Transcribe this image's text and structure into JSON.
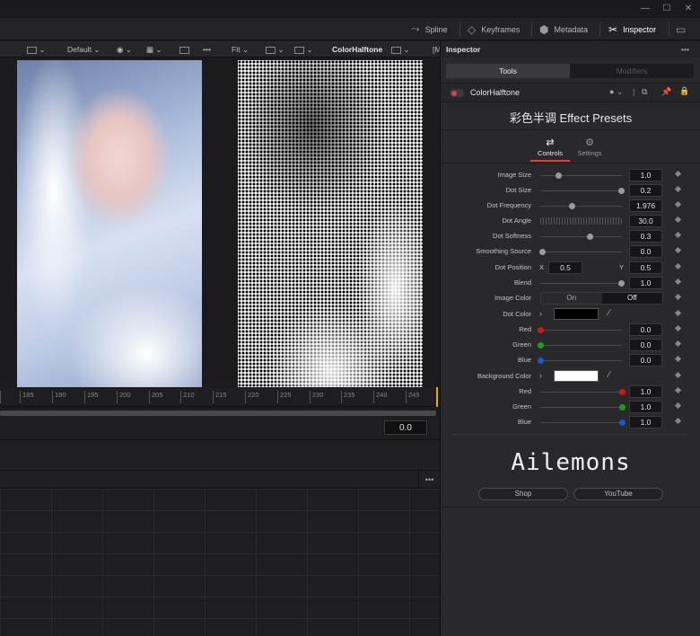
{
  "window": {
    "min": "—",
    "max": "☐",
    "close": "✕"
  },
  "toptabs": [
    {
      "label": "Spline",
      "icon": "spline-icon"
    },
    {
      "label": "Keyframes",
      "icon": "keyframes-icon"
    },
    {
      "label": "Metadata",
      "icon": "metadata-icon"
    },
    {
      "label": "Inspector",
      "icon": "inspector-icon"
    }
  ],
  "viewer": {
    "layout": "Default",
    "fit": "Fit",
    "node": "ColorHalftone",
    "more": "•••",
    "clip": "[M"
  },
  "ruler": {
    "ticks": [
      "185",
      "190",
      "195",
      "200",
      "205",
      "210",
      "215",
      "220",
      "225",
      "230",
      "235",
      "240",
      "245"
    ]
  },
  "time": {
    "value": "0.0"
  },
  "inspector": {
    "title": "Inspector",
    "tabs": [
      "Tools",
      "Modifiers"
    ],
    "node_name": "ColorHalftone",
    "preset_title": "彩色半调 Effect Presets",
    "subtabs": [
      "Controls",
      "Settings"
    ],
    "params": [
      {
        "label": "Image Size",
        "value": "1.0",
        "level": 0.22
      },
      {
        "label": "Dot Size",
        "value": "0.2",
        "level": 0.99
      },
      {
        "label": "Dot Frequency",
        "value": "1.976",
        "level": 0.38
      },
      {
        "label": "Dot Angle",
        "value": "30.0"
      },
      {
        "label": "Dot Softness",
        "value": "0.3",
        "level": 0.6
      },
      {
        "label": "Smoothing Source",
        "value": "0.0",
        "level": 0.02
      },
      {
        "label": "Dot Position",
        "x_label": "X",
        "x": "0.5",
        "y_label": "Y",
        "y": "0.5"
      },
      {
        "label": "Blend",
        "value": "1.0",
        "level": 0.99
      },
      {
        "label": "Image Color",
        "on": "On",
        "off": "Off"
      },
      {
        "label": "Dot Color",
        "swatch": "#000000"
      },
      {
        "label": "Red",
        "value": "0.0",
        "color": "#d01818",
        "level": 0
      },
      {
        "label": "Green",
        "value": "0.0",
        "color": "#18a018",
        "level": 0
      },
      {
        "label": "Blue",
        "value": "0.0",
        "color": "#1858d0",
        "level": 0
      },
      {
        "label": "Background Color",
        "swatch": "#ffffff"
      },
      {
        "label": "Red",
        "value": "1.0",
        "color": "#d01818",
        "level": 1
      },
      {
        "label": "Green",
        "value": "1.0",
        "color": "#18a018",
        "level": 1
      },
      {
        "label": "Blue",
        "value": "1.0",
        "color": "#1858d0",
        "level": 1
      }
    ],
    "brand": "Ailemons",
    "shop": "Shop",
    "youtube": "YouTube"
  },
  "accent": "#e04040"
}
